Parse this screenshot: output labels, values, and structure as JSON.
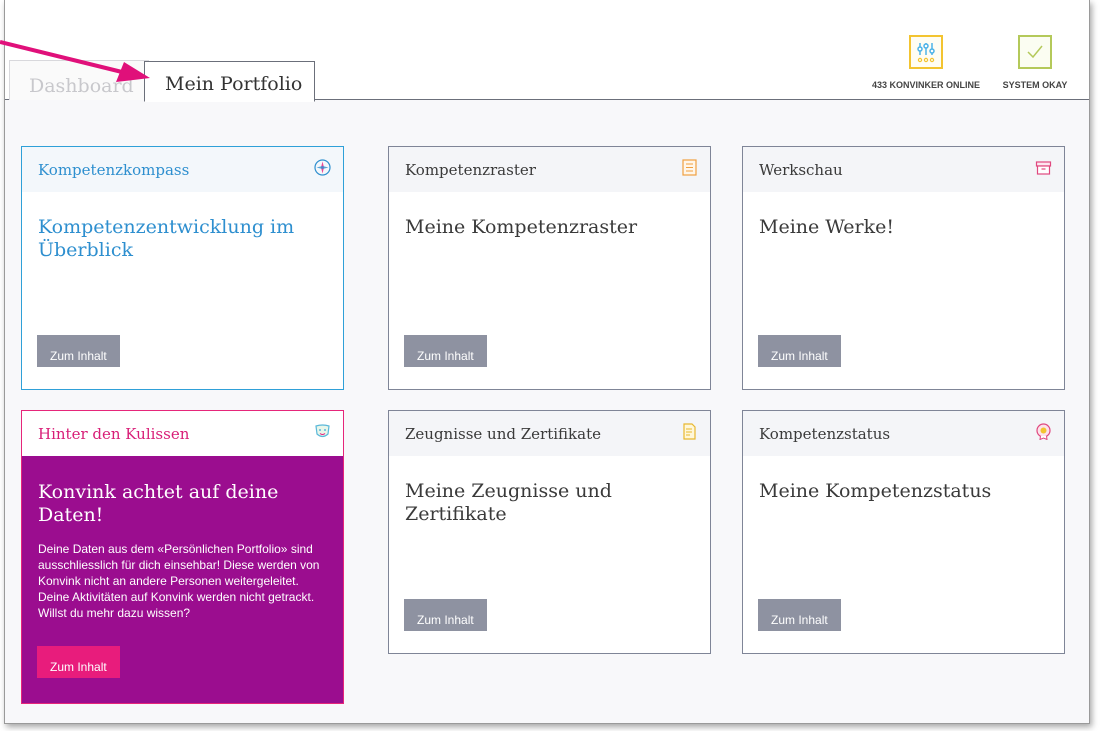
{
  "tabs": [
    {
      "label": "Dashboard",
      "active": false
    },
    {
      "label": "Mein Portfolio",
      "active": true
    }
  ],
  "status": {
    "online": {
      "label": "433 KONVINKER ONLINE",
      "icon": "sliders-icon"
    },
    "system": {
      "label": "SYSTEM OKAY",
      "icon": "checkmark-icon"
    }
  },
  "cards": [
    {
      "header": "Kompetenzkompass",
      "icon": "compass-icon",
      "title": "Kompetenzentwicklung im Überblick",
      "button": "Zum Inhalt"
    },
    {
      "header": "Kompetenzraster",
      "icon": "grid-list-icon",
      "title": "Meine Kompetenzraster",
      "button": "Zum Inhalt"
    },
    {
      "header": "Werkschau",
      "icon": "archive-box-icon",
      "title": "Meine Werke!",
      "button": "Zum Inhalt"
    },
    {
      "header": "Hinter den Kulissen",
      "icon": "mask-icon",
      "title": "Konvink achtet auf deine Daten!",
      "description": "Deine Daten aus dem «Persönlichen Portfolio» sind ausschliesslich für dich einsehbar! Diese werden von Konvink nicht an andere Personen weitergeleitet. Deine Aktivitäten auf Konvink werden nicht getrackt. Willst du mehr dazu wissen?",
      "button": "Zum Inhalt"
    },
    {
      "header": "Zeugnisse und Zertifikate",
      "icon": "certificate-icon",
      "title": "Meine Zeugnisse und Zertifikate",
      "button": "Zum Inhalt"
    },
    {
      "header": "Kompetenzstatus",
      "icon": "status-badge-icon",
      "title": "Meine Kompetenzstatus",
      "button": "Zum Inhalt"
    }
  ],
  "colors": {
    "accent_blue": "#2e8fcf",
    "accent_pink": "#e81c7c",
    "privacy_purple": "#9b0d8f",
    "button_gray": "#8e92a1",
    "annotation_arrow": "#e0107a"
  }
}
